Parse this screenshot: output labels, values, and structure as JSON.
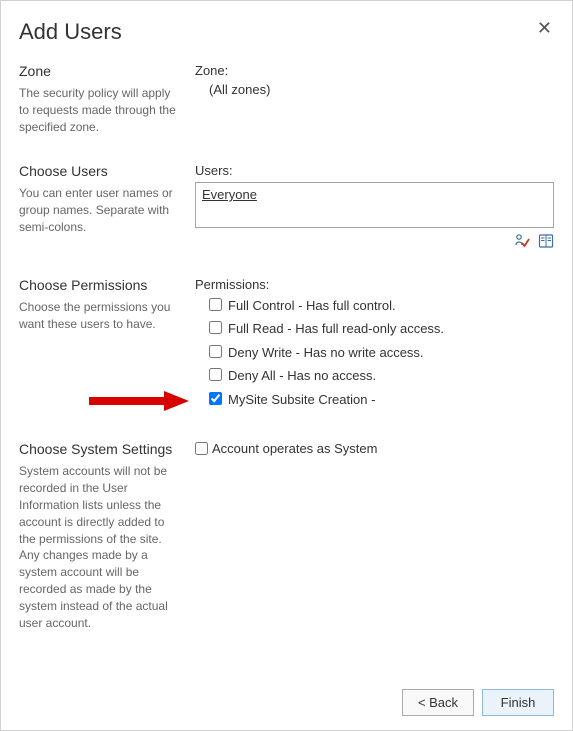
{
  "title": "Add Users",
  "sections": {
    "zone": {
      "title": "Zone",
      "desc": "The security policy will apply to requests made through the specified zone.",
      "fieldLabel": "Zone:",
      "fieldValue": "(All zones)"
    },
    "users": {
      "title": "Choose Users",
      "desc": "You can enter user names or group names. Separate with semi-colons.",
      "fieldLabel": "Users:",
      "value": "Everyone"
    },
    "permissions": {
      "title": "Choose Permissions",
      "desc": "Choose the permissions you want these users to have.",
      "fieldLabel": "Permissions:",
      "items": [
        {
          "label": "Full Control - Has full control.",
          "checked": false
        },
        {
          "label": "Full Read - Has full read-only access.",
          "checked": false
        },
        {
          "label": "Deny Write - Has no write access.",
          "checked": false
        },
        {
          "label": "Deny All - Has no access.",
          "checked": false
        },
        {
          "label": "MySite Subsite Creation -",
          "checked": true
        }
      ]
    },
    "system": {
      "title": "Choose System Settings",
      "desc": "System accounts will not be recorded in the User Information lists unless the account is directly added to the permissions of the site. Any changes made by a system account will be recorded as made by the system instead of the actual user account.",
      "checkboxLabel": "Account operates as System"
    }
  },
  "buttons": {
    "back": "< Back",
    "finish": "Finish"
  }
}
